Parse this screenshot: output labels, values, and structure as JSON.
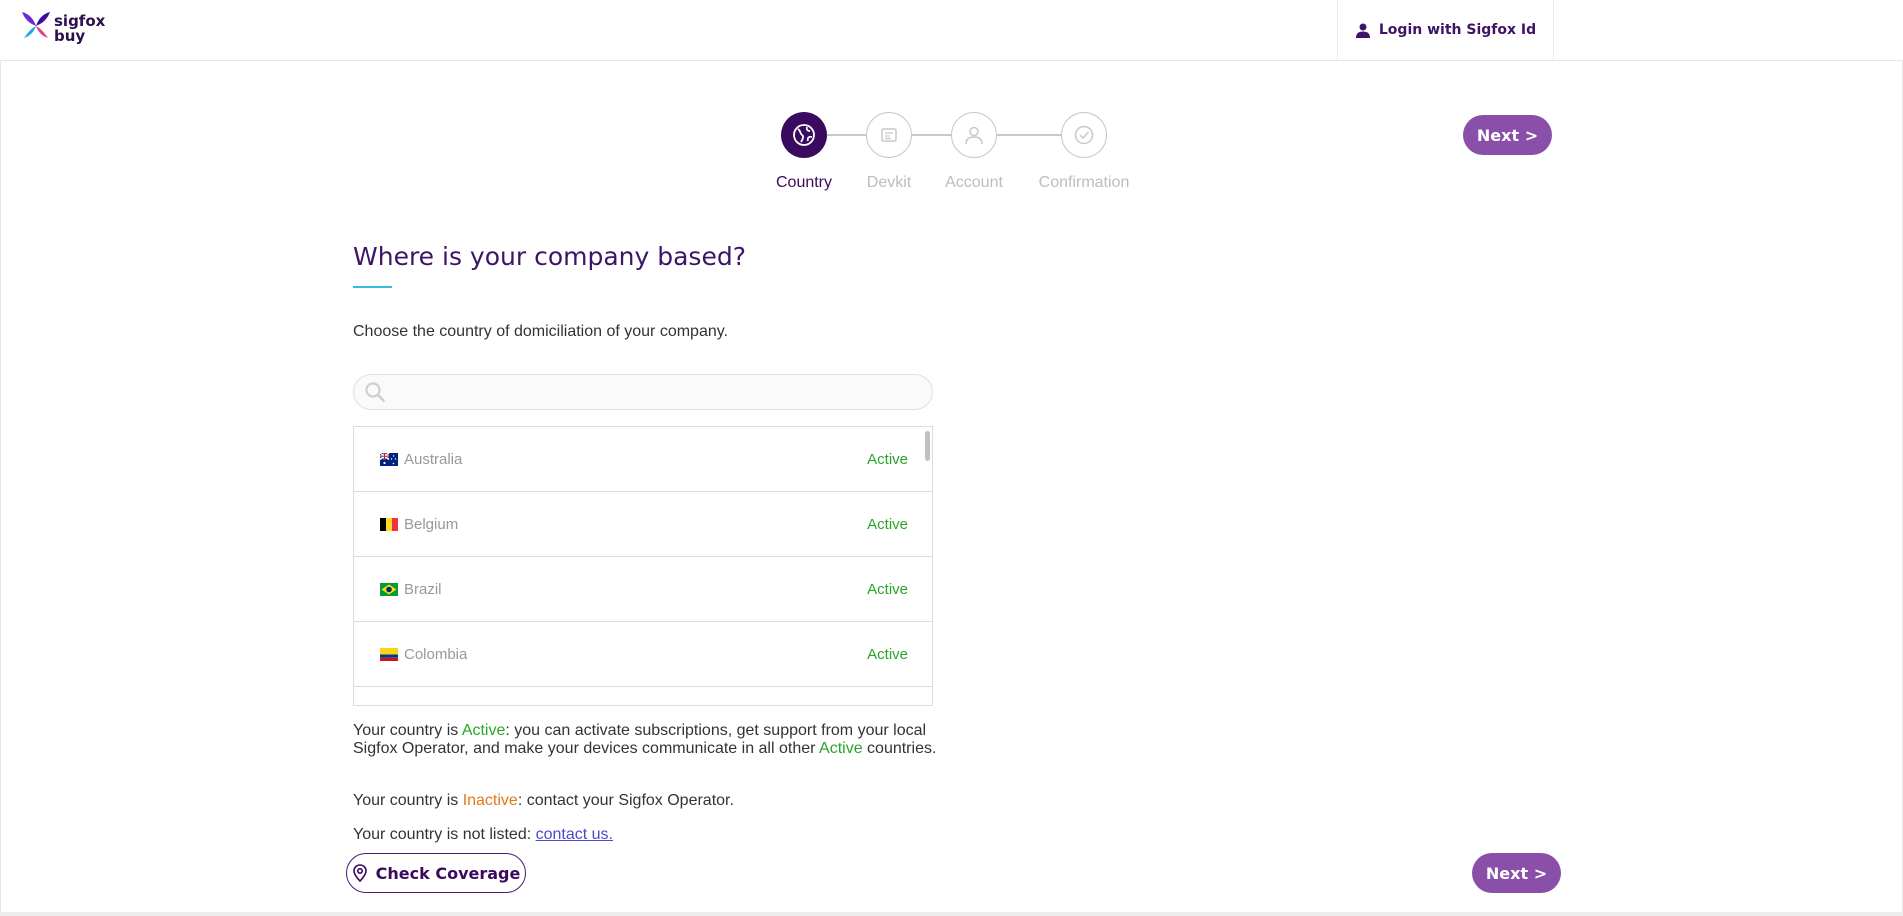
{
  "header": {
    "logo_line1": "sigfox",
    "logo_line2": "buy",
    "login_label": "Login with Sigfox Id",
    "login_icon": "user-icon"
  },
  "stepper": {
    "steps": [
      {
        "label": "Country",
        "icon": "globe-icon",
        "active": true
      },
      {
        "label": "Devkit",
        "icon": "devkit-icon",
        "active": false
      },
      {
        "label": "Account",
        "icon": "user-icon",
        "active": false
      },
      {
        "label": "Confirmation",
        "icon": "check-icon",
        "active": false
      }
    ]
  },
  "buttons": {
    "next_top": "Next >",
    "next_bottom": "Next >",
    "check_coverage": "Check Coverage"
  },
  "main": {
    "title": "Where is your company based?",
    "intro": "Choose the country of domiciliation of your company."
  },
  "search": {
    "value": "",
    "placeholder": ""
  },
  "countries": [
    {
      "name": "Australia",
      "status": "Active",
      "flag": "australia"
    },
    {
      "name": "Belgium",
      "status": "Active",
      "flag": "belgium"
    },
    {
      "name": "Brazil",
      "status": "Active",
      "flag": "brazil"
    },
    {
      "name": "Colombia",
      "status": "Active",
      "flag": "colombia"
    }
  ],
  "explanations": {
    "active_prefix": "Your country is ",
    "active_word": "Active",
    "active_middle": ": you can activate subscriptions, get support from your local Sigfox Operator, and make your devices communicate in all other ",
    "active_word2": "Active",
    "active_suffix": " countries.",
    "inactive_prefix": "Your country is ",
    "inactive_word": "Inactive",
    "inactive_suffix": ": contact your Sigfox Operator.",
    "notlisted_prefix": "Your country is not listed: ",
    "notlisted_link": "contact us."
  },
  "colors": {
    "brand_dark": "#3a0a5e",
    "button": "#8a4fa8",
    "active_status": "#2aa52a",
    "inactive_status": "#e07a1a",
    "accent_underline": "#34bde0"
  }
}
